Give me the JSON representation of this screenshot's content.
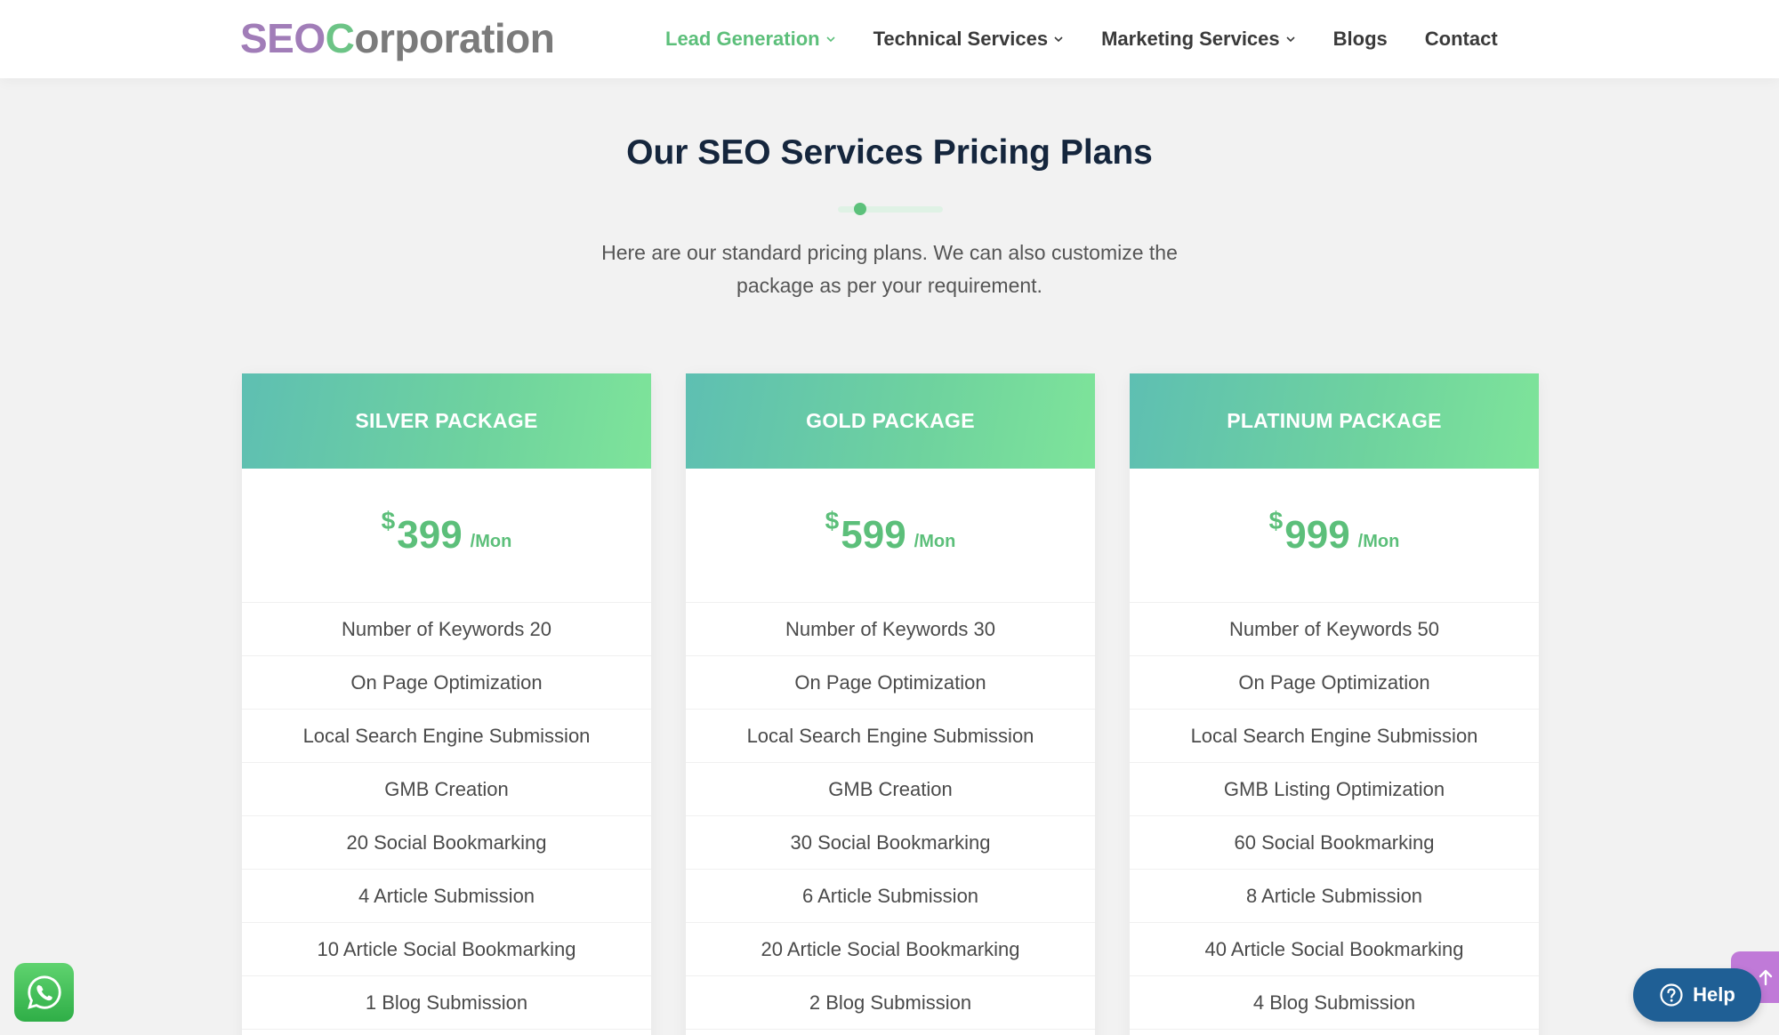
{
  "header": {
    "logo": {
      "part1": "SEO",
      "part2": "C",
      "part3": "orporation"
    },
    "nav": [
      {
        "label": "Lead Generation",
        "has_dropdown": true,
        "active": true
      },
      {
        "label": "Technical Services",
        "has_dropdown": true,
        "active": false
      },
      {
        "label": "Marketing Services",
        "has_dropdown": true,
        "active": false
      },
      {
        "label": "Blogs",
        "has_dropdown": false,
        "active": false
      },
      {
        "label": "Contact",
        "has_dropdown": false,
        "active": false
      }
    ]
  },
  "section": {
    "title": "Our SEO Services Pricing Plans",
    "subtitle_line1": "Here are our standard pricing plans. We can also customize the",
    "subtitle_line2": "package as per your requirement."
  },
  "plans": [
    {
      "name": "SILVER PACKAGE",
      "currency": "$",
      "price": "399",
      "period": "/Mon",
      "features": [
        "Number of Keywords 20",
        "On Page Optimization",
        "Local Search Engine Submission",
        "GMB Creation",
        "20 Social Bookmarking",
        "4 Article Submission",
        "10 Article Social Bookmarking",
        "1 Blog Submission"
      ]
    },
    {
      "name": "GOLD PACKAGE",
      "currency": "$",
      "price": "599",
      "period": "/Mon",
      "features": [
        "Number of Keywords 30",
        "On Page Optimization",
        "Local Search Engine Submission",
        "GMB Creation",
        "30 Social Bookmarking",
        "6 Article Submission",
        "20 Article Social Bookmarking",
        "2 Blog Submission"
      ]
    },
    {
      "name": "PLATINUM PACKAGE",
      "currency": "$",
      "price": "999",
      "period": "/Mon",
      "features": [
        "Number of Keywords 50",
        "On Page Optimization",
        "Local Search Engine Submission",
        "GMB Listing Optimization",
        "60 Social Bookmarking",
        "8 Article Submission",
        "40 Article Social Bookmarking",
        "4 Blog Submission"
      ]
    }
  ],
  "widgets": {
    "help_label": "Help",
    "whatsapp_icon": "whatsapp-icon",
    "scroll_top_icon": "arrow-up-icon",
    "help_icon": "question-circle-icon"
  },
  "colors": {
    "accent_green": "#5cbf7a",
    "heading_navy": "#15263d",
    "logo_purple": "#a17db8",
    "help_blue": "#1f5f95",
    "scroll_purple": "#c07ad8"
  }
}
